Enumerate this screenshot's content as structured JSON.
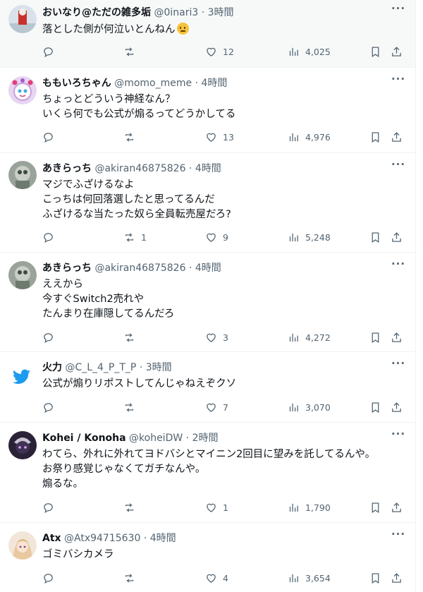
{
  "tweets": [
    {
      "name": "おいなり@ただの雑多垢",
      "handle": "@0inari3",
      "time": "3時間",
      "lines": [
        "落とした側が何泣いとんねん"
      ],
      "emoji": "confused-face",
      "replies": "",
      "retweets": "",
      "likes": "12",
      "views": "4,025"
    },
    {
      "name": "ももいろちゃん",
      "handle": "@momo_meme",
      "time": "4時間",
      "lines": [
        "ちょっとどういう神経なん？",
        "いくら何でも公式が煽るってどうかしてる"
      ],
      "replies": "",
      "retweets": "",
      "likes": "13",
      "views": "4,976"
    },
    {
      "name": "あきらっち",
      "handle": "@akiran46875826",
      "time": "4時間",
      "lines": [
        "マジでふざけるなよ",
        "こっちは何回落選したと思ってるんだ",
        "ふざけるな当たった奴ら全員転売屋だろ?"
      ],
      "replies": "",
      "retweets": "1",
      "likes": "9",
      "views": "5,248"
    },
    {
      "name": "あきらっち",
      "handle": "@akiran46875826",
      "time": "4時間",
      "lines": [
        "ええから",
        "今すぐSwitch2売れや",
        "たんまり在庫隠してるんだろ"
      ],
      "replies": "",
      "retweets": "",
      "likes": "3",
      "views": "4,272"
    },
    {
      "name": "火力",
      "handle": "@C_L_4_P_T_P",
      "time": "3時間",
      "lines": [
        "公式が煽りリポストしてんじゃねえぞクソ"
      ],
      "replies": "",
      "retweets": "",
      "likes": "7",
      "views": "3,070"
    },
    {
      "name": "Kohei / Konoha",
      "handle": "@koheiDW",
      "time": "2時間",
      "lines": [
        "わてら、外れに外れてヨドバシとマイニン2回目に望みを託してるんや。",
        "お祭り感覚じゃなくてガチなんや。",
        "煽るな。"
      ],
      "replies": "",
      "retweets": "",
      "likes": "1",
      "views": "1,790"
    },
    {
      "name": "Atx",
      "handle": "@Atx94715630",
      "time": "4時間",
      "lines": [
        "ゴミバシカメラ"
      ],
      "replies": "",
      "retweets": "",
      "likes": "4",
      "views": "3,654"
    }
  ],
  "separator": "·",
  "colors": {
    "text": "#0f1419",
    "secondary": "#536471",
    "border": "#eff3f4",
    "twitter_blue": "#1d9bf0"
  }
}
